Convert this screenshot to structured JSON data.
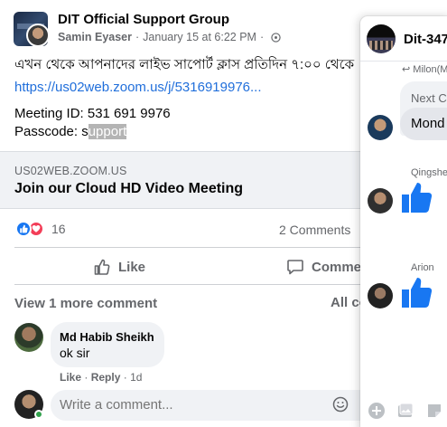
{
  "post": {
    "group_name": "DIT Official Support Group",
    "author": "Samin Eyaser",
    "date": "January 15 at 6:22 PM",
    "separator": "·",
    "text": "এখন থেকে আপনাদের লাইভ সাপোর্ট ক্লাস প্রতিদিন ৭:০০ থেকে",
    "link": "https://us02web.zoom.us/j/5316919976...",
    "meeting_id": "Meeting ID: 531 691 9976",
    "passcode_prefix": "Passcode: s",
    "passcode_highlight": "upport",
    "preview": {
      "domain": "US02WEB.ZOOM.US",
      "title": "Join our Cloud HD Video Meeting"
    },
    "reactions": {
      "count": "16",
      "comments": "2 Comments"
    },
    "actions": {
      "like": "Like",
      "comment": "Comment"
    },
    "view_more": "View 1 more comment",
    "all_comments": "All co",
    "comment": {
      "name": "Md Habib Sheikh",
      "text": "ok sir",
      "like": "Like",
      "reply": "Reply",
      "time": "1d"
    },
    "write_placeholder": "Write a comment..."
  },
  "chat": {
    "title": "Dit-347",
    "reply_tag": "Milon(M",
    "reply_quote": "Next C",
    "message": "Mond",
    "sender1": "Qingshe",
    "sender2": "Arion"
  },
  "colors": {
    "link": "#216fdb",
    "like_blue": "#1877f2",
    "love_red": "#f33e58",
    "muted": "#65676b",
    "bubble": "#f0f2f5"
  }
}
